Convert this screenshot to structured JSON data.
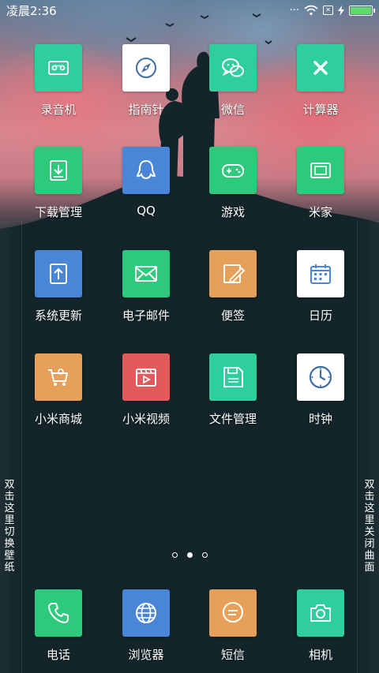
{
  "status_bar": {
    "time": "凌晨2:36",
    "sim_icon_text": "✕",
    "battery_level": 1.0
  },
  "colors": {
    "teal": "#2ecf9c",
    "green": "#2dca7c",
    "blue": "#4a86d8",
    "orange": "#e7a05a",
    "red": "#e35a5a",
    "white": "#ffffff"
  },
  "apps": [
    {
      "label": "录音机",
      "icon": "cassette-icon",
      "color": "#2ecf9c"
    },
    {
      "label": "指南针",
      "icon": "compass-icon",
      "color": "#ffffff"
    },
    {
      "label": "微信",
      "icon": "chat-bubbles-icon",
      "color": "#2ecf9c"
    },
    {
      "label": "计算器",
      "icon": "calculator-x-icon",
      "color": "#2ecf9c"
    },
    {
      "label": "下载管理",
      "icon": "download-icon",
      "color": "#2dca7c"
    },
    {
      "label": "QQ",
      "icon": "qq-icon",
      "color": "#4a86d8"
    },
    {
      "label": "游戏",
      "icon": "gamepad-icon",
      "color": "#2dca7c"
    },
    {
      "label": "米家",
      "icon": "device-icon",
      "color": "#2dca7c"
    },
    {
      "label": "系统更新",
      "icon": "upload-icon",
      "color": "#4a86d8"
    },
    {
      "label": "电子邮件",
      "icon": "envelope-icon",
      "color": "#2dca7c"
    },
    {
      "label": "便签",
      "icon": "note-pencil-icon",
      "color": "#e7a05a"
    },
    {
      "label": "日历",
      "icon": "calendar-icon",
      "color": "#ffffff"
    },
    {
      "label": "小米商城",
      "icon": "cart-icon",
      "color": "#e7a05a"
    },
    {
      "label": "小米视频",
      "icon": "video-icon",
      "color": "#e35a5a"
    },
    {
      "label": "文件管理",
      "icon": "floppy-icon",
      "color": "#2ecf9c"
    },
    {
      "label": "时钟",
      "icon": "clock-icon",
      "color": "#ffffff"
    }
  ],
  "dock": [
    {
      "label": "电话",
      "icon": "phone-icon",
      "color": "#2dca7c"
    },
    {
      "label": "浏览器",
      "icon": "globe-icon",
      "color": "#4a86d8"
    },
    {
      "label": "短信",
      "icon": "message-icon",
      "color": "#e7a05a"
    },
    {
      "label": "相机",
      "icon": "camera-icon",
      "color": "#2ecf9c"
    }
  ],
  "side_left": "双击这里切换壁纸",
  "side_right": "双击这里关闭曲面",
  "pages": {
    "count": 3,
    "current": 2
  }
}
